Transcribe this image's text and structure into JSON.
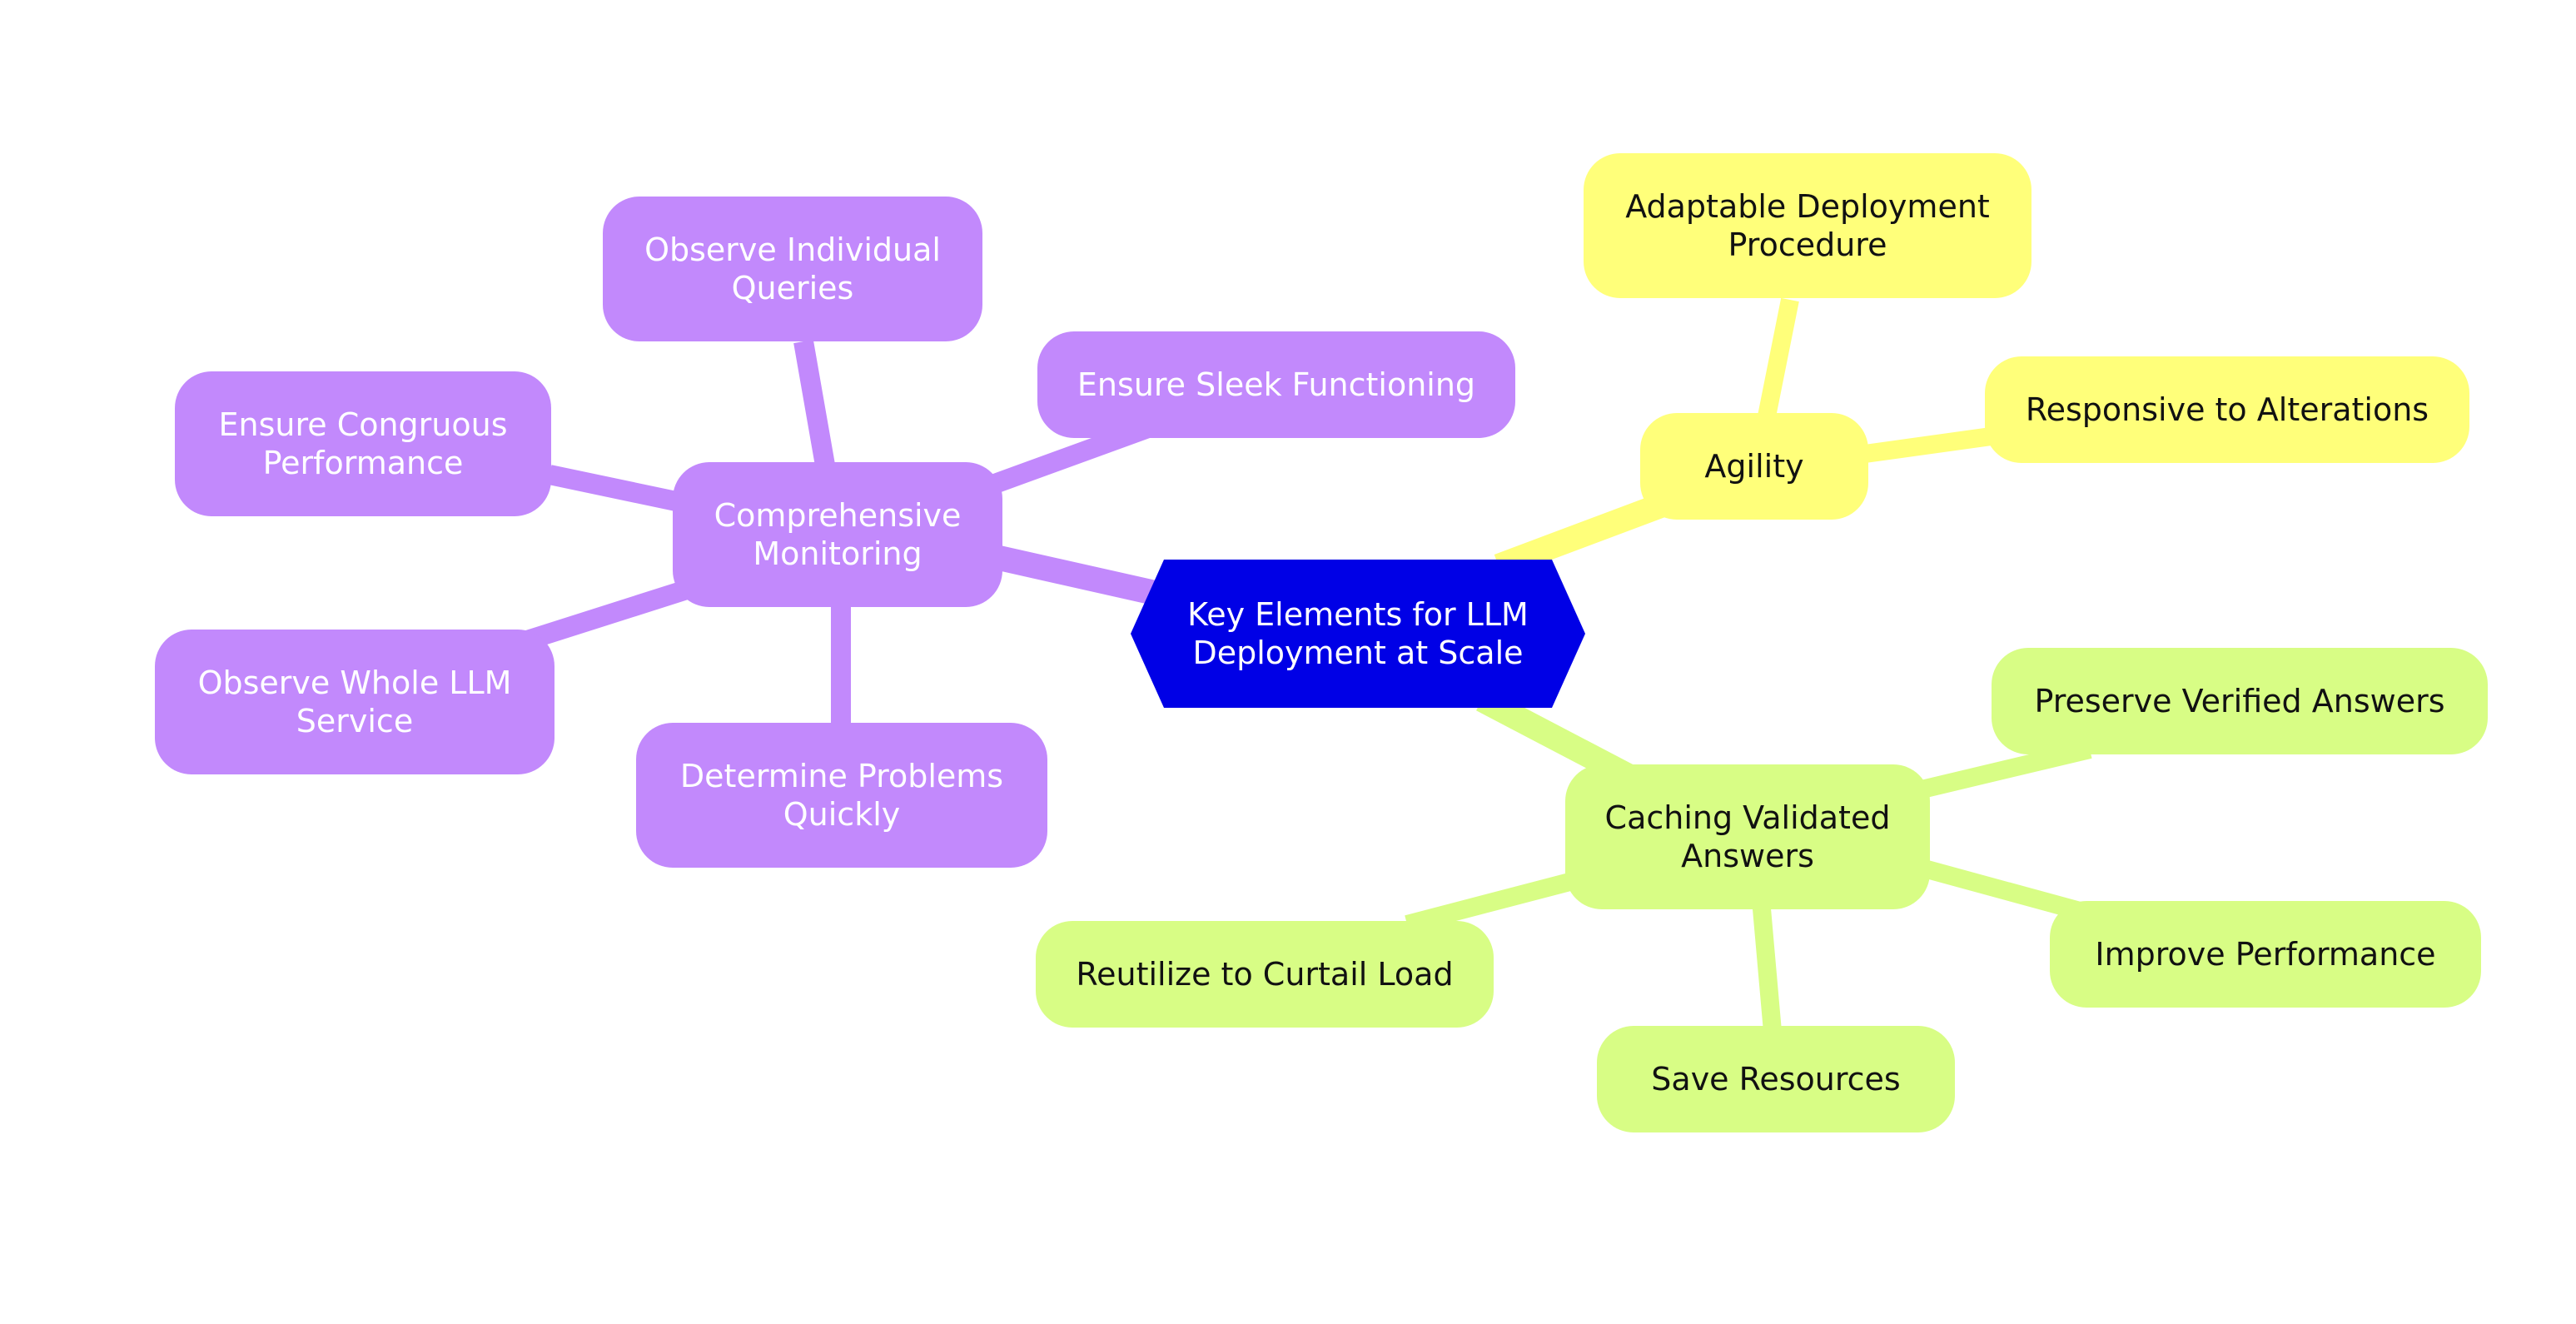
{
  "title": "Key Elements for LLM Deployment at Scale",
  "colors": {
    "root": "#0000e6",
    "monitoring": "#c289fc",
    "agility": "#ffff7a",
    "caching": "#d8fd85",
    "root_text": "#ffffff",
    "monitoring_text": "#ffffff",
    "dark_text": "#111111"
  },
  "root": {
    "label": "Key Elements for LLM\nDeployment at Scale"
  },
  "branches": [
    {
      "id": "monitoring",
      "label": "Comprehensive\nMonitoring",
      "children": [
        {
          "id": "m1",
          "label": "Observe Individual\nQueries"
        },
        {
          "id": "m2",
          "label": "Ensure Sleek Functioning"
        },
        {
          "id": "m3",
          "label": "Ensure Congruous\nPerformance"
        },
        {
          "id": "m4",
          "label": "Observe Whole LLM\nService"
        },
        {
          "id": "m5",
          "label": "Determine Problems\nQuickly"
        }
      ]
    },
    {
      "id": "agility",
      "label": "Agility",
      "children": [
        {
          "id": "a1",
          "label": "Adaptable Deployment\nProcedure"
        },
        {
          "id": "a2",
          "label": "Responsive to Alterations"
        }
      ]
    },
    {
      "id": "caching",
      "label": "Caching Validated\nAnswers",
      "children": [
        {
          "id": "c1",
          "label": "Preserve Verified Answers"
        },
        {
          "id": "c2",
          "label": "Improve Performance"
        },
        {
          "id": "c3",
          "label": "Save Resources"
        },
        {
          "id": "c4",
          "label": "Reutilize to Curtail Load"
        }
      ]
    }
  ]
}
